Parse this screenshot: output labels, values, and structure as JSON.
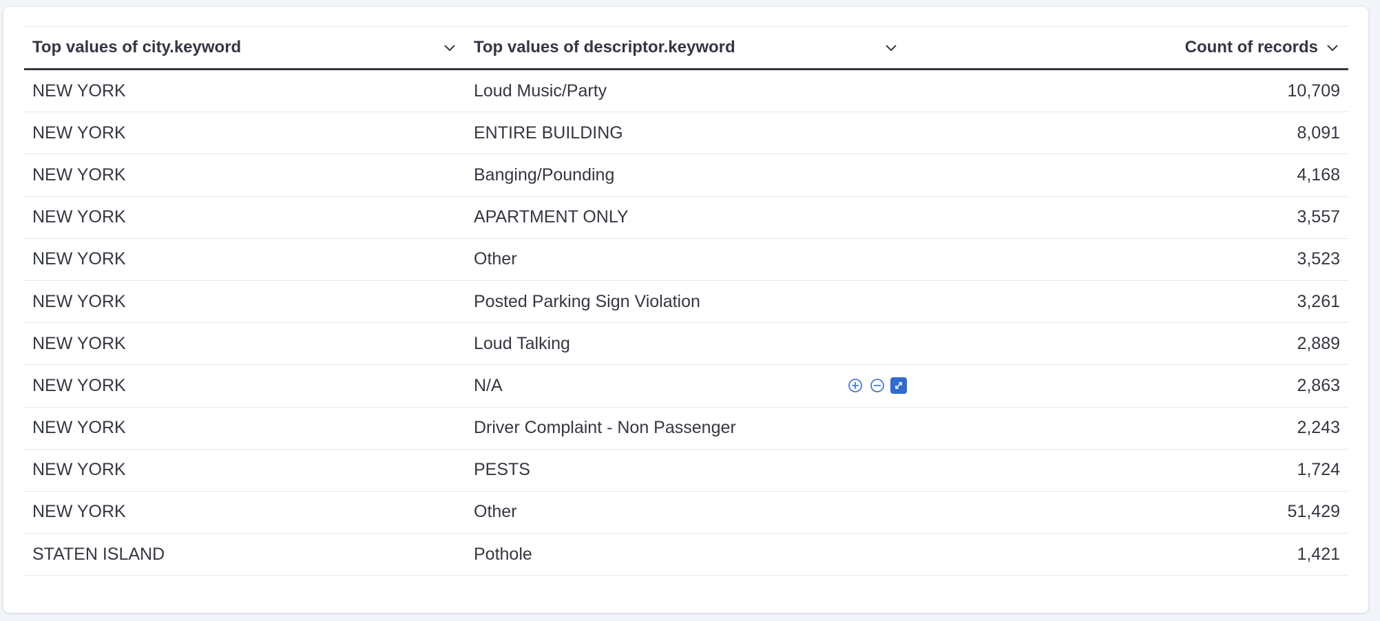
{
  "columns": [
    {
      "label": "Top values of city.keyword"
    },
    {
      "label": "Top values of descriptor.keyword"
    },
    {
      "label": "Count of records"
    }
  ],
  "rows": [
    {
      "city": "NEW YORK",
      "descriptor": "Loud Music/Party",
      "count": "10,709"
    },
    {
      "city": "NEW YORK",
      "descriptor": "ENTIRE BUILDING",
      "count": "8,091"
    },
    {
      "city": "NEW YORK",
      "descriptor": "Banging/Pounding",
      "count": "4,168"
    },
    {
      "city": "NEW YORK",
      "descriptor": "APARTMENT ONLY",
      "count": "3,557"
    },
    {
      "city": "NEW YORK",
      "descriptor": "Other",
      "count": "3,523"
    },
    {
      "city": "NEW YORK",
      "descriptor": "Posted Parking Sign Violation",
      "count": "3,261"
    },
    {
      "city": "NEW YORK",
      "descriptor": "Loud Talking",
      "count": "2,889"
    },
    {
      "city": "NEW YORK",
      "descriptor": "N/A",
      "count": "2,863"
    },
    {
      "city": "NEW YORK",
      "descriptor": "Driver Complaint - Non Passenger",
      "count": "2,243"
    },
    {
      "city": "NEW YORK",
      "descriptor": "PESTS",
      "count": "1,724"
    },
    {
      "city": "NEW YORK",
      "descriptor": "Other",
      "count": "51,429"
    },
    {
      "city": "STATEN ISLAND",
      "descriptor": "Pothole",
      "count": "1,421"
    }
  ],
  "hovered_row": 7,
  "icons": {
    "sort": "chevron-down-icon",
    "filter_in": "plus-circle-icon",
    "filter_out": "minus-circle-icon",
    "expand": "expand-icon"
  },
  "colors": {
    "text": "#343741",
    "accent": "#2f6bd0",
    "border": "#e3e8f0"
  }
}
